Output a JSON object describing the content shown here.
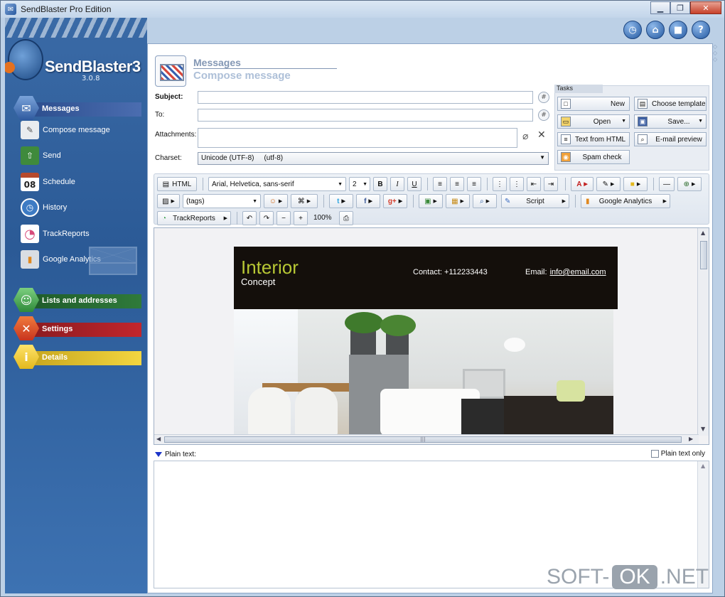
{
  "window": {
    "title": "SendBlaster Pro Edition",
    "minimize": "▁",
    "restore": "❐",
    "close": "✕"
  },
  "logo": {
    "text": "SendBlaster3",
    "version": "3.0.8"
  },
  "top_icons": [
    "clock-icon",
    "home-icon",
    "video-icon",
    "help-icon"
  ],
  "top_icon_glyphs": [
    "◷",
    "⌂",
    "■",
    "?"
  ],
  "sidebar": {
    "sections": [
      {
        "label": "Messages",
        "color": "#3a5a9c",
        "icon": "envelope-icon",
        "glyph": "✉"
      },
      {
        "label": "Lists and addresses",
        "color": "#2f7a3a",
        "icon": "user-icon",
        "glyph": "☺"
      },
      {
        "label": "Settings",
        "color": "#b8262c",
        "icon": "tools-icon",
        "glyph": "✕"
      },
      {
        "label": "Details",
        "color": "#e8c62a",
        "icon": "info-icon",
        "glyph": "i"
      }
    ],
    "items": [
      {
        "label": "Compose message",
        "icon": "compose-icon",
        "glyph": "✎",
        "color": "#e9ecef"
      },
      {
        "label": "Send",
        "icon": "send-icon",
        "glyph": "⇧",
        "color": "#3f8a3c"
      },
      {
        "label": "Schedule",
        "icon": "calendar-icon",
        "glyph": "08",
        "color": "#b64a2e"
      },
      {
        "label": "History",
        "icon": "history-icon",
        "glyph": "◷",
        "color": "#3d7bc4"
      },
      {
        "label": "TrackReports",
        "icon": "pie-chart-icon",
        "glyph": "◔",
        "color": "#d84b7b"
      },
      {
        "label": "Google Analytics",
        "icon": "bar-chart-icon",
        "glyph": "▮",
        "color": "#d9dde3"
      }
    ]
  },
  "header": {
    "title": "Messages",
    "subtitle": "Compose message"
  },
  "form": {
    "subject_label": "Subject:",
    "to_label": "To:",
    "attachments_label": "Attachments:",
    "charset_label": "Charset:",
    "hash": "#",
    "paperclip": "⌀",
    "remove": "✕",
    "charset_value": "Unicode (UTF-8)",
    "charset_code": "(utf-8)",
    "caret": "▼"
  },
  "tasks": {
    "title": "Tasks",
    "buttons": [
      {
        "label": "New",
        "icon": "new-document-icon",
        "glyph": "□"
      },
      {
        "label": "Choose template",
        "icon": "template-icon",
        "glyph": "▤"
      },
      {
        "label": "Open",
        "icon": "open-folder-icon",
        "glyph": "▭"
      },
      {
        "label": "Save...",
        "icon": "save-icon",
        "glyph": "▣"
      },
      {
        "label": "Text from HTML",
        "icon": "text-from-html-icon",
        "glyph": "≡"
      },
      {
        "label": "E-mail preview",
        "icon": "preview-icon",
        "glyph": "⌕"
      },
      {
        "label": "Spam check",
        "icon": "spam-check-icon",
        "glyph": "◉"
      }
    ],
    "dropdown": "▼"
  },
  "toolbar": {
    "html_label": "HTML",
    "font_value": "Arial, Helvetica, sans-serif",
    "size_value": "2",
    "bold": "B",
    "italic": "I",
    "underline": "U",
    "tags_value": "(tags)",
    "script_label": "Script",
    "ga_label": "Google Analytics",
    "trackreports_label": "TrackReports",
    "zoom": "100%",
    "arrow": "▶",
    "caret": "▼",
    "glyphs": {
      "align_left": "≡",
      "align_center": "≡",
      "align_right": "≡",
      "ul": "⋮",
      "ol": "⋮",
      "outdent": "⇤",
      "indent": "⇥",
      "font_color": "A",
      "highlight": "✎",
      "bg": "■",
      "hr": "—",
      "link": "⊕",
      "image": "▨",
      "personalize": "☺",
      "snippet": "⌘",
      "twitter": "t",
      "facebook": "f",
      "gplus": "g+",
      "preview": "▣",
      "media": "▦",
      "find": "⌕",
      "undo": "↶",
      "redo": "↷",
      "zoom_out": "−",
      "zoom_in": "+",
      "print": "⎙"
    }
  },
  "email": {
    "brand": "Interior",
    "brand_sub": "Concept",
    "contact": "Contact: +112233443",
    "email_label": "Email:",
    "email_value": "info@email.com"
  },
  "scroll": {
    "up": "▲",
    "down": "▼",
    "left": "◀",
    "right": "▶",
    "grip": "|||"
  },
  "plain": {
    "label": "Plain text:",
    "checkbox": "Plain text only"
  },
  "watermark": {
    "left": "SOFT-",
    "ok": "OK",
    "right": ".NET"
  },
  "right_grip": "◇\n◇\n◇"
}
